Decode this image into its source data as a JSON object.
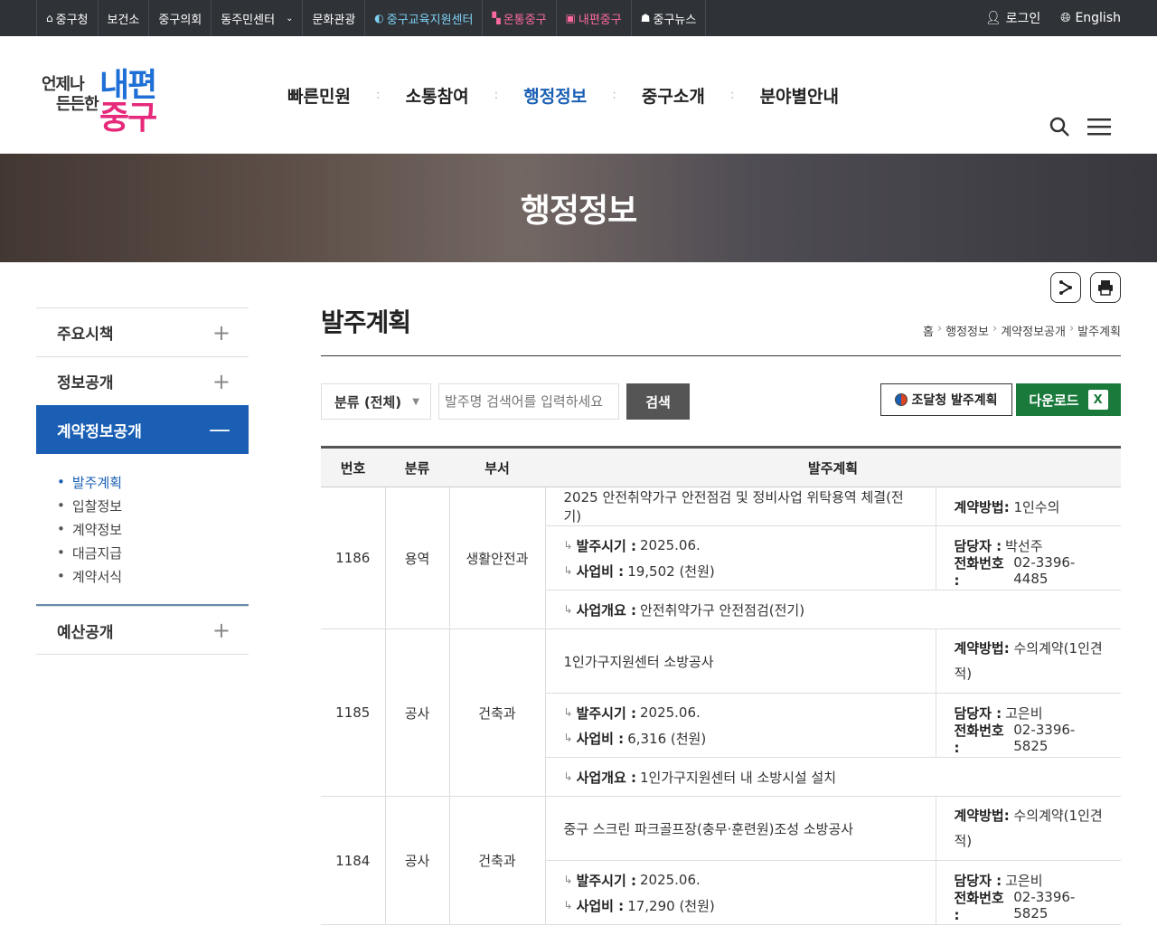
{
  "topbar": {
    "links": [
      {
        "label": "중구청",
        "icon": "home-icon"
      },
      {
        "label": "보건소"
      },
      {
        "label": "중구의회"
      },
      {
        "label": "동주민센터",
        "dropdown": true
      },
      {
        "label": "문화관광"
      },
      {
        "label": "중구교육지원센터",
        "style": "edu"
      },
      {
        "label": "온통중구",
        "style": "pink"
      },
      {
        "label": "내편중구",
        "style": "pink"
      },
      {
        "label": "중구뉴스"
      }
    ],
    "login": "로그인",
    "english": "English"
  },
  "header": {
    "logo_small_1": "언제나",
    "logo_small_2": "든든한",
    "logo_big_1": "내편",
    "logo_big_2": "중구",
    "menu": [
      "빠른민원",
      "소통참여",
      "행정정보",
      "중구소개",
      "분야별안내"
    ],
    "active_menu": "행정정보"
  },
  "banner": {
    "title": "행정정보"
  },
  "lnb": {
    "items": [
      {
        "label": "주요시책"
      },
      {
        "label": "정보공개"
      },
      {
        "label": "계약정보공개"
      },
      {
        "label": "예산공개"
      }
    ],
    "sub": [
      "발주계획",
      "입찰정보",
      "계약정보",
      "대금지급",
      "계약서식"
    ]
  },
  "page": {
    "title": "발주계획",
    "breadcrumb": [
      "홈",
      "행정정보",
      "계약정보공개",
      "발주계획"
    ]
  },
  "search": {
    "category": "분류 (전체)",
    "placeholder": "발주명 검색어를 입력하세요",
    "button": "검색",
    "jodal_button": "조달청 발주계획",
    "download_button": "다운로드",
    "excel_icon": "X"
  },
  "table": {
    "headers": [
      "번호",
      "분류",
      "부서",
      "발주계획"
    ],
    "labels": {
      "method": "계약방법:",
      "period": "발주시기 :",
      "cost": "사업비 :",
      "manager": "담당자 :",
      "phone": "전화번호 :",
      "summary": "사업개요 :"
    },
    "rows": [
      {
        "no": "1186",
        "cat": "용역",
        "dept": "생활안전과",
        "name": "2025 안전취약가구 안전점검 및 정비사업 위탁용역 체결(전기)",
        "method": "1인수의",
        "period": "2025.06.",
        "cost": "19,502 (천원)",
        "manager": "박선주",
        "phone": "02-3396-4485",
        "summary": "안전취약가구 안전점검(전기)"
      },
      {
        "no": "1185",
        "cat": "공사",
        "dept": "건축과",
        "name": "1인가구지원센터 소방공사",
        "method": "수의계약(1인견적)",
        "period": "2025.06.",
        "cost": "6,316 (천원)",
        "manager": "고은비",
        "phone": "02-3396-5825",
        "summary": "1인가구지원센터 내 소방시설 설치"
      },
      {
        "no": "1184",
        "cat": "공사",
        "dept": "건축과",
        "name": "중구 스크린 파크골프장(충무·훈련원)조성 소방공사",
        "method": "수의계약(1인견적)",
        "period": "2025.06.",
        "cost": "17,290 (천원)",
        "manager": "고은비",
        "phone": "02-3396-5825",
        "summary": ""
      }
    ]
  }
}
